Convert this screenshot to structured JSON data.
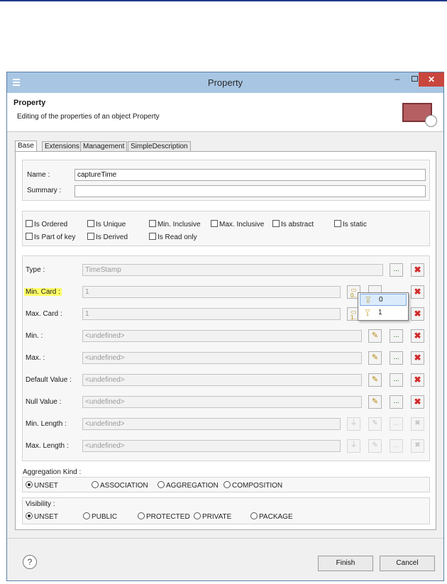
{
  "window": {
    "title": "Property"
  },
  "header": {
    "title": "Property",
    "subtitle": "Editing of the properties of an object Property"
  },
  "tabs": [
    "Base",
    "Extensions",
    "Management",
    "SimpleDescription"
  ],
  "base": {
    "name_label": "Name :",
    "name_value": "captureTime",
    "summary_label": "Summary :",
    "summary_value": ""
  },
  "checkboxes": [
    {
      "label": "Is Ordered",
      "checked": false
    },
    {
      "label": "Is Unique",
      "checked": false
    },
    {
      "label": "Min. Inclusive",
      "checked": false
    },
    {
      "label": "Max. Inclusive",
      "checked": false
    },
    {
      "label": "Is abstract",
      "checked": false
    },
    {
      "label": "Is static",
      "checked": false
    },
    {
      "label": "Is Part of key",
      "checked": false
    },
    {
      "label": "Is Derived",
      "checked": false
    },
    {
      "label": "Is Read only",
      "checked": false
    }
  ],
  "fields": [
    {
      "label": "Type :",
      "value": "TimeStamp"
    },
    {
      "label": "Min. Card :",
      "value": "1"
    },
    {
      "label": "Max. Card :",
      "value": "1"
    },
    {
      "label": "Min. :",
      "value": "<undefined>"
    },
    {
      "label": "Max. :",
      "value": "<undefined>"
    },
    {
      "label": "Default Value :",
      "value": "<undefined>"
    },
    {
      "label": "Null Value :",
      "value": "<undefined>"
    },
    {
      "label": "Min. Length :",
      "value": "<undefined>"
    },
    {
      "label": "Max. Length :",
      "value": "<undefined>"
    }
  ],
  "cardinality_popup": {
    "options": [
      "0",
      "1"
    ],
    "selected": "0"
  },
  "aggregation": {
    "label": "Aggregation Kind :",
    "options": [
      "UNSET",
      "ASSOCIATION",
      "AGGREGATION",
      "COMPOSITION"
    ],
    "selected": "UNSET"
  },
  "visibility": {
    "label": "Visibility :",
    "options": [
      "UNSET",
      "PUBLIC",
      "PROTECTED",
      "PRIVATE",
      "PACKAGE"
    ],
    "selected": "UNSET"
  },
  "buttons": {
    "browse": "...",
    "delete": "✖",
    "edit": "✎",
    "help": "?",
    "finish": "Finish",
    "cancel": "Cancel"
  },
  "colors": {
    "titlebar": "#a8c6e3",
    "close": "#c9463d",
    "highlight": "#ffff66"
  }
}
